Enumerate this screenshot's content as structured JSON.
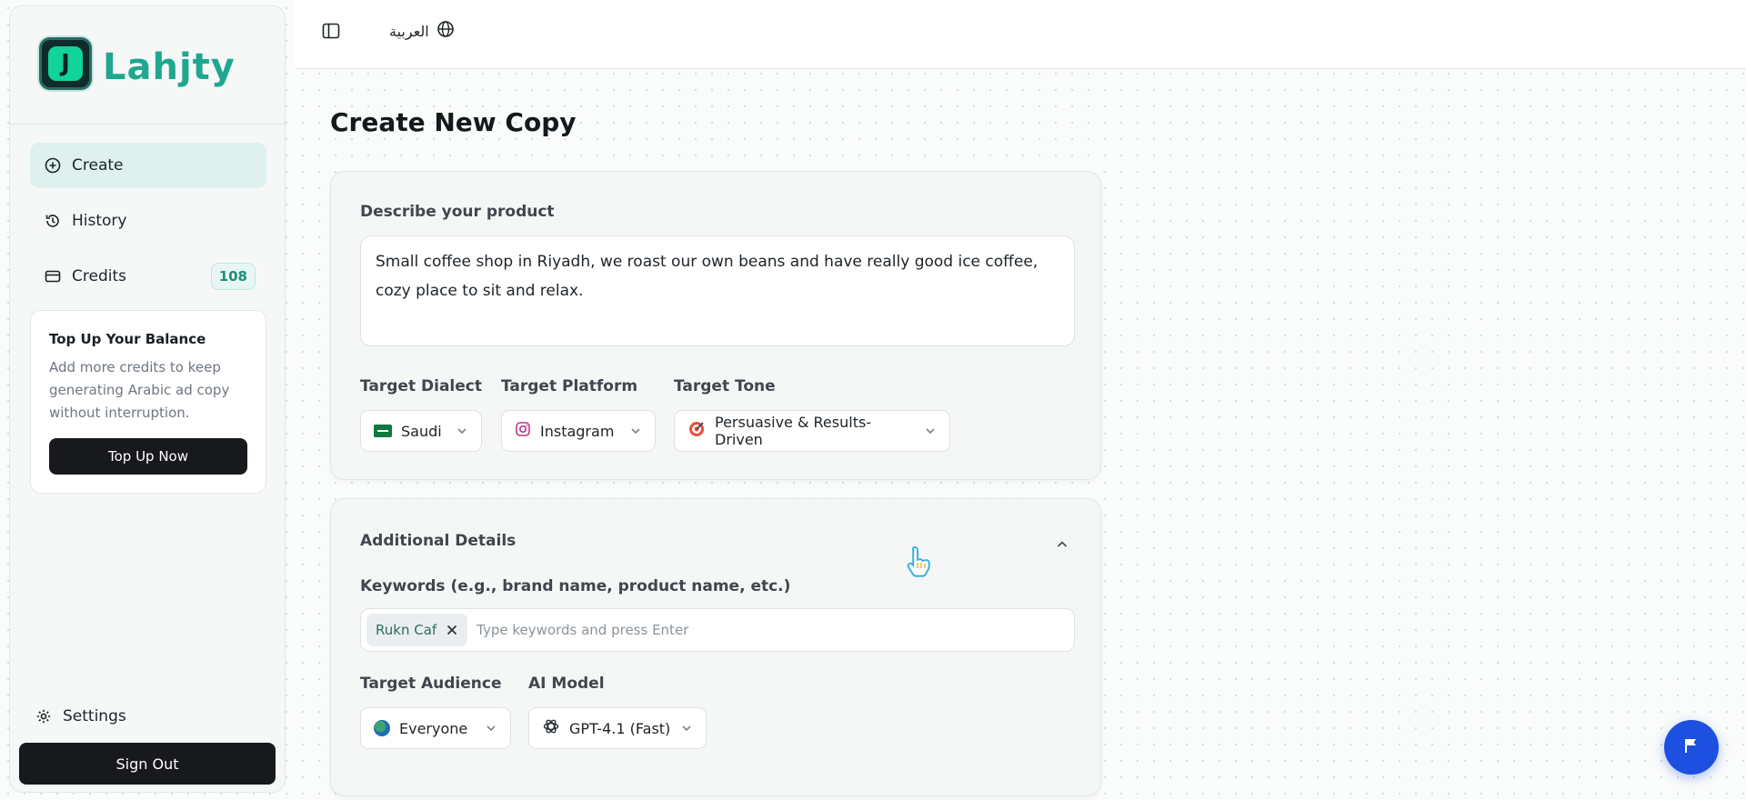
{
  "brand": {
    "logo_letter": "J",
    "name": "Lahjty",
    "accent": "#1fa88f"
  },
  "sidebar": {
    "items": [
      {
        "label": "Create",
        "icon": "plus-circle-icon",
        "active": true
      },
      {
        "label": "History",
        "icon": "history-icon"
      },
      {
        "label": "Credits",
        "icon": "credit-card-icon",
        "badge": "108"
      }
    ],
    "topup": {
      "title": "Top Up Your Balance",
      "description": "Add more credits to keep generating Arabic ad copy without interruption.",
      "button": "Top Up Now"
    },
    "settings_label": "Settings",
    "signout_label": "Sign Out"
  },
  "topbar": {
    "language_label": "العربية",
    "language_icon": "globe-icon",
    "toggle_icon": "sidebar-toggle-icon"
  },
  "main": {
    "title": "Create New Copy",
    "product": {
      "label": "Describe your product",
      "value": "Small coffee shop in Riyadh, we roast our own beans and have really good ice coffee, cozy place  to sit and relax."
    },
    "dialect": {
      "label": "Target Dialect",
      "value": "Saudi",
      "icon": "saudi-flag-icon"
    },
    "platform": {
      "label": "Target Platform",
      "value": "Instagram",
      "icon": "instagram-icon"
    },
    "tone": {
      "label": "Target Tone",
      "value": "Persuasive & Results-Driven",
      "icon": "target-icon"
    },
    "additional": {
      "title": "Additional Details",
      "keywords_label": "Keywords (e.g., brand name, product name, etc.)",
      "keywords": [
        "Rukn Caf"
      ],
      "keywords_placeholder": "Type keywords and press Enter",
      "audience": {
        "label": "Target Audience",
        "value": "Everyone",
        "icon": "globe-icon"
      },
      "model": {
        "label": "AI Model",
        "value": "GPT-4.1 (Fast)",
        "icon": "openai-icon"
      }
    }
  },
  "fab_icon": "flag-icon",
  "colors": {
    "primary_dark": "#17191c",
    "fab": "#1d4fe0",
    "active_nav": "#dff1ee"
  }
}
